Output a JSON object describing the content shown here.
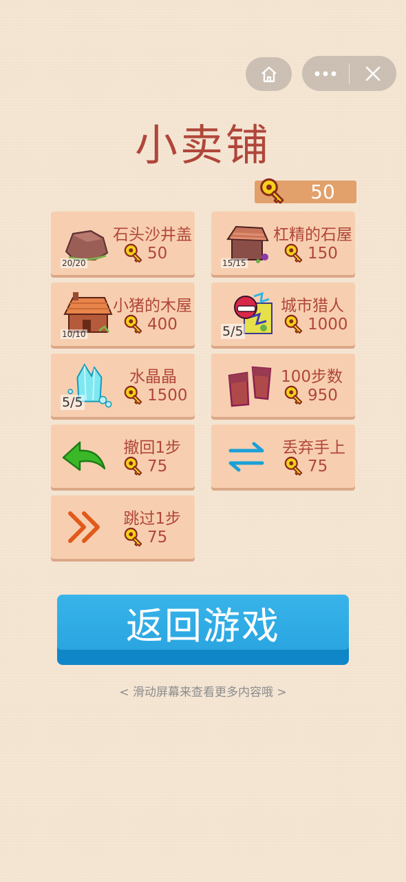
{
  "title": "小卖铺",
  "balance": "50",
  "items": [
    {
      "name": "石头沙井盖",
      "price": "50",
      "count": "20/20"
    },
    {
      "name": "杠精的石屋",
      "price": "150",
      "count": "15/15"
    },
    {
      "name": "小猪的木屋",
      "price": "400",
      "count": "10/10"
    },
    {
      "name": "城市猎人",
      "price": "1000",
      "count": "5/5"
    },
    {
      "name": "水晶晶",
      "price": "1500",
      "count": "5/5"
    },
    {
      "name": "100步数",
      "price": "950"
    },
    {
      "name": "撤回1步",
      "price": "75"
    },
    {
      "name": "丢弃手上",
      "price": "75"
    },
    {
      "name": "跳过1步",
      "price": "75"
    }
  ],
  "back_button": "返回游戏",
  "hint": "< 滑动屏幕来查看更多内容哦 >",
  "colors": {
    "accent": "#b0463a",
    "card": "#f7cfb0",
    "button": "#2aa5e0",
    "coin_bar": "#e2a06a"
  }
}
